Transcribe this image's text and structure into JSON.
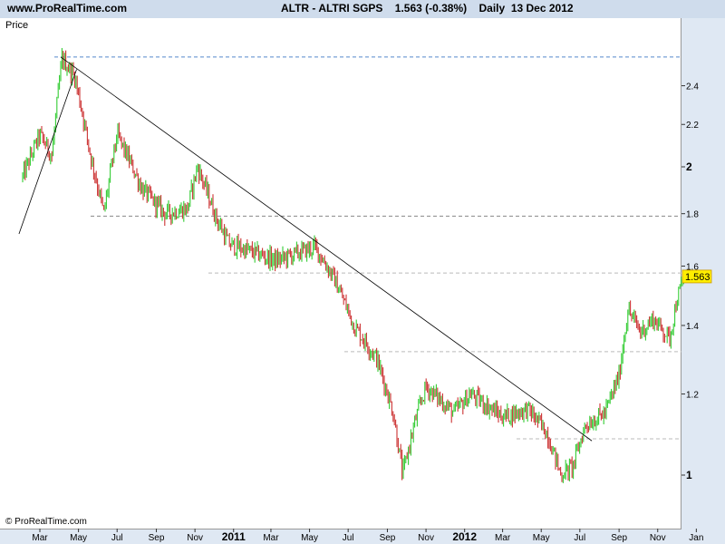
{
  "header": {
    "site": "www.ProRealTime.com",
    "title": "ALTR - ALTRI SGPS    1.563 (-0.38%)    Daily  13 Dec 2012"
  },
  "panel": {
    "price_label": "Price",
    "copyright": "© ProRealTime.com"
  },
  "colors": {
    "up": "#33cc33",
    "down": "#cc3333",
    "trendline": "#000000",
    "dashed": "#999999",
    "top_dashed": "#5588cc",
    "last_price_bg": "#ffee00"
  },
  "chart_data": {
    "type": "candlestick",
    "title": "ALTR - ALTRI SGPS",
    "last_price": "1.563",
    "y_scale": "log",
    "ylim": [
      0.92,
      2.58
    ],
    "y_ticks": [
      "2.4",
      "2.2",
      "2",
      "1.8",
      "1.6",
      "1.4",
      "1.2",
      "1"
    ],
    "x_ticks": [
      "Mar",
      "May",
      "Jul",
      "Sep",
      "Nov",
      "2011",
      "Mar",
      "May",
      "Jul",
      "Sep",
      "Nov",
      "2012",
      "Mar",
      "May",
      "Jul",
      "Sep",
      "Nov",
      "Jan"
    ],
    "price_path": [
      {
        "date": "2010-02-01",
        "price": 1.95
      },
      {
        "date": "2010-03-01",
        "price": 2.15
      },
      {
        "date": "2010-03-20",
        "price": 2.05
      },
      {
        "date": "2010-04-05",
        "price": 2.55
      },
      {
        "date": "2010-04-25",
        "price": 2.45
      },
      {
        "date": "2010-05-20",
        "price": 2.05
      },
      {
        "date": "2010-06-10",
        "price": 1.8
      },
      {
        "date": "2010-07-01",
        "price": 2.15
      },
      {
        "date": "2010-08-10",
        "price": 1.9
      },
      {
        "date": "2010-09-15",
        "price": 1.8
      },
      {
        "date": "2010-10-20",
        "price": 1.82
      },
      {
        "date": "2010-11-05",
        "price": 2.0
      },
      {
        "date": "2010-12-05",
        "price": 1.78
      },
      {
        "date": "2010-12-25",
        "price": 1.68
      },
      {
        "date": "2011-02-01",
        "price": 1.65
      },
      {
        "date": "2011-03-10",
        "price": 1.62
      },
      {
        "date": "2011-05-10",
        "price": 1.67
      },
      {
        "date": "2011-06-10",
        "price": 1.55
      },
      {
        "date": "2011-07-10",
        "price": 1.4
      },
      {
        "date": "2011-08-15",
        "price": 1.3
      },
      {
        "date": "2011-09-10",
        "price": 1.15
      },
      {
        "date": "2011-09-25",
        "price": 1.0
      },
      {
        "date": "2011-10-15",
        "price": 1.13
      },
      {
        "date": "2011-11-01",
        "price": 1.22
      },
      {
        "date": "2011-12-15",
        "price": 1.15
      },
      {
        "date": "2012-01-10",
        "price": 1.2
      },
      {
        "date": "2012-03-01",
        "price": 1.14
      },
      {
        "date": "2012-04-10",
        "price": 1.16
      },
      {
        "date": "2012-05-10",
        "price": 1.1
      },
      {
        "date": "2012-06-01",
        "price": 1.0
      },
      {
        "date": "2012-06-20",
        "price": 1.02
      },
      {
        "date": "2012-07-10",
        "price": 1.12
      },
      {
        "date": "2012-08-10",
        "price": 1.15
      },
      {
        "date": "2012-09-01",
        "price": 1.25
      },
      {
        "date": "2012-09-15",
        "price": 1.45
      },
      {
        "date": "2012-10-05",
        "price": 1.38
      },
      {
        "date": "2012-10-25",
        "price": 1.42
      },
      {
        "date": "2012-11-20",
        "price": 1.36
      },
      {
        "date": "2012-12-01",
        "price": 1.48
      },
      {
        "date": "2012-12-13",
        "price": 1.563
      }
    ],
    "trendlines": [
      {
        "from": {
          "date": "2010-01-27",
          "price": 1.72
        },
        "to": {
          "date": "2010-04-28",
          "price": 2.49
        }
      },
      {
        "from": {
          "date": "2010-04-03",
          "price": 2.56
        },
        "to": {
          "date": "2012-07-20",
          "price": 1.08
        }
      }
    ],
    "horizontal_lines": [
      {
        "price": 2.56,
        "style": "dashed-blue"
      },
      {
        "price": 1.79,
        "style": "dashed"
      },
      {
        "price": 1.575,
        "style": "dashed-light"
      },
      {
        "price": 1.32,
        "style": "dashed-light"
      },
      {
        "price": 1.085,
        "style": "dashed-light"
      }
    ],
    "grid": false,
    "legend": "none"
  }
}
